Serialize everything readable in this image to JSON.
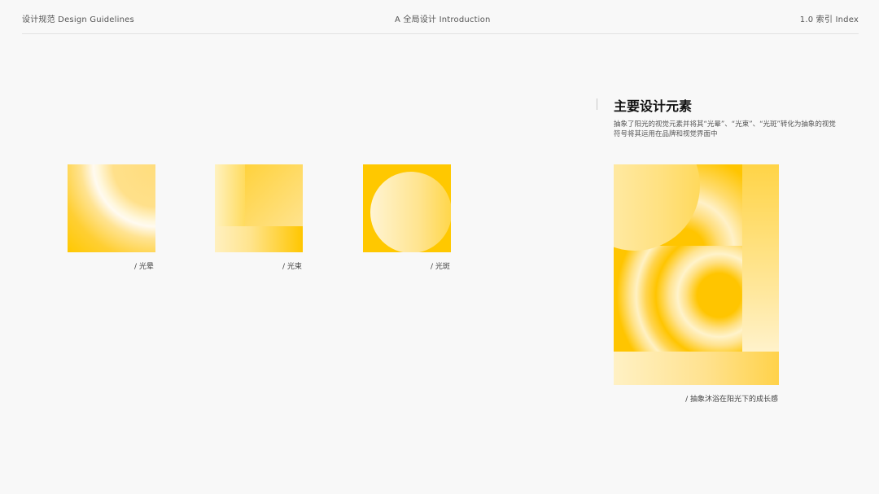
{
  "header": {
    "left": "设计规范 Design Guidelines",
    "center": "A 全局设计 Introduction",
    "right": "1.0  索引 Index"
  },
  "swatches": [
    {
      "caption": "/ 光晕"
    },
    {
      "caption": "/ 光束"
    },
    {
      "caption": "/ 光斑"
    }
  ],
  "section": {
    "title": "主要设计元素",
    "description": "抽象了阳光的视觉元素并将其“光晕”、“光束”、“光斑”转化为抽象的视觉符号将其运用在品牌和视觉界面中"
  },
  "poster": {
    "caption": "/ 抽象沐浴在阳光下的成长感"
  },
  "colors": {
    "background": "#f8f8f8",
    "accent_yellow": "#ffc800",
    "light_yellow": "#fff4d2",
    "rule": "#e1e1e1"
  }
}
